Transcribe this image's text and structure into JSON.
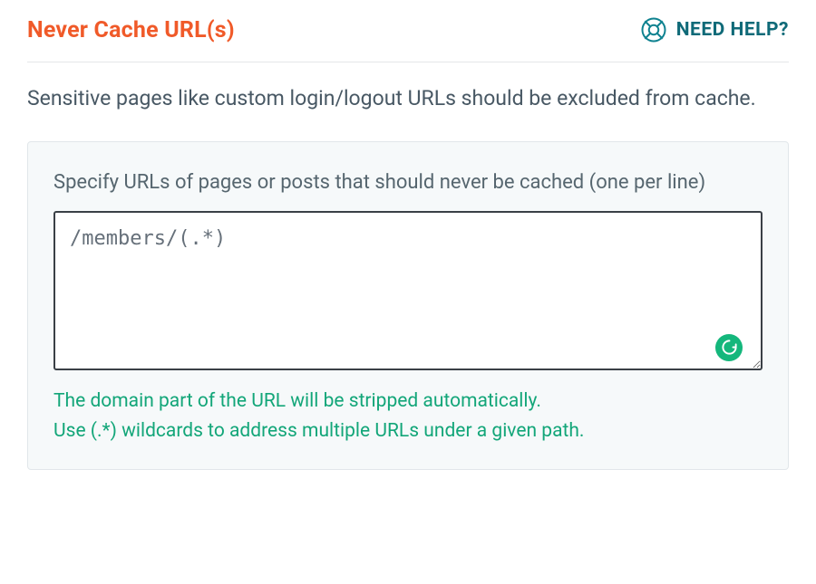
{
  "header": {
    "title": "Never Cache URL(s)",
    "help_label": "NEED HELP?"
  },
  "description": "Sensitive pages like custom login/logout URLs should be excluded from cache.",
  "panel": {
    "field_label": "Specify URLs of pages or posts that should never be cached (one per line)",
    "textarea_value": "/members/(.*)",
    "hint_line1": "The domain part of the URL will be stripped automatically.",
    "hint_line2": "Use (.*) wildcards to address multiple URLs under a given path."
  }
}
